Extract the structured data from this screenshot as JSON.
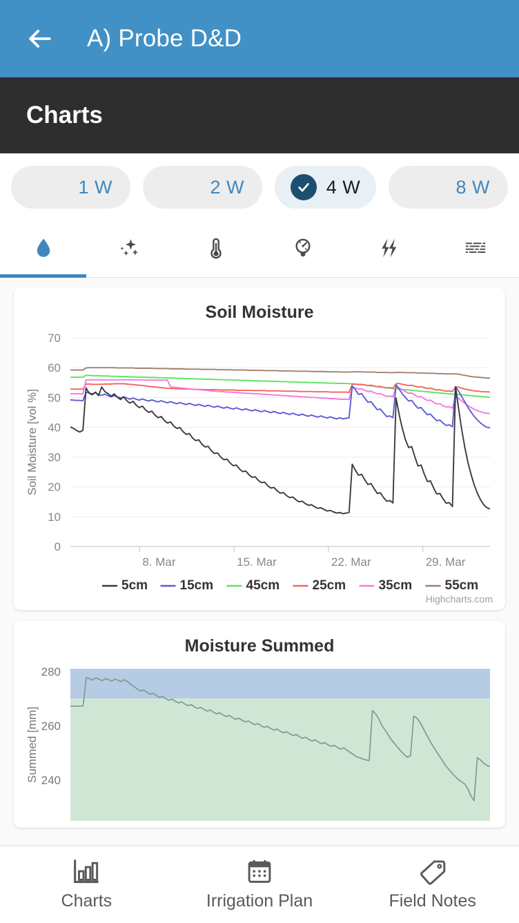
{
  "appbar": {
    "back_icon": "arrow-left-icon",
    "title": "A) Probe D&D",
    "bg_color": "#4191c6"
  },
  "section_header": {
    "title": "Charts",
    "bg_color": "#2e2e2e"
  },
  "range_chips": {
    "selected_index": 2,
    "check_icon": "check-circle-icon",
    "items": [
      {
        "label": "1 W",
        "selected": false
      },
      {
        "label": "2 W",
        "selected": false
      },
      {
        "label": "4 W",
        "selected": true
      },
      {
        "label": "8 W",
        "selected": false
      }
    ]
  },
  "metric_tabs": {
    "active_index": 0,
    "accent_color": "#3f87bf",
    "items": [
      {
        "icon": "water-drop-icon",
        "active": true
      },
      {
        "icon": "sparkles-icon",
        "active": false
      },
      {
        "icon": "thermometer-icon",
        "active": false
      },
      {
        "icon": "gauge-icon",
        "active": false
      },
      {
        "icon": "lightning-bolts-icon",
        "active": false
      },
      {
        "icon": "data-rows-icon",
        "active": false
      }
    ]
  },
  "chart_data": [
    {
      "type": "line",
      "title": "Soil Moisture",
      "xlabel": "",
      "ylabel": "Soil Moisture [vol %]",
      "ylim": [
        0,
        70
      ],
      "yticks": [
        0,
        10,
        20,
        30,
        40,
        50,
        60,
        70
      ],
      "xticks": [
        "8. Mar",
        "15. Mar",
        "22. Mar",
        "29. Mar"
      ],
      "xtick_positions": [
        0.165,
        0.39,
        0.615,
        0.84
      ],
      "grid": true,
      "legend_position": "bottom",
      "credits": "Highcharts.com",
      "series": [
        {
          "name": "5cm",
          "color": "#3a3a3a",
          "values": [
            40.1,
            39.6,
            38.9,
            38.4,
            39.0,
            53.2,
            51.4,
            50.9,
            51.8,
            50.6,
            53.5,
            52.0,
            51.3,
            50.4,
            51.2,
            50.1,
            49.3,
            50.2,
            48.9,
            48.1,
            48.7,
            47.4,
            46.6,
            47.1,
            45.8,
            45.0,
            45.4,
            44.1,
            43.2,
            43.6,
            42.3,
            41.4,
            41.8,
            40.4,
            39.6,
            39.9,
            38.5,
            37.6,
            37.9,
            36.4,
            35.5,
            35.8,
            34.3,
            33.4,
            33.6,
            32.1,
            31.2,
            31.4,
            30.0,
            29.1,
            29.3,
            28.0,
            27.1,
            27.3,
            26.0,
            25.1,
            25.3,
            24.1,
            23.2,
            23.4,
            22.2,
            21.4,
            21.6,
            20.4,
            19.6,
            19.8,
            18.7,
            17.9,
            18.1,
            17.1,
            16.4,
            16.6,
            15.7,
            15.0,
            15.2,
            14.4,
            13.8,
            14.0,
            13.3,
            12.8,
            13.0,
            12.4,
            11.9,
            12.1,
            11.6,
            11.2,
            11.4,
            11.0,
            11.2,
            11.4,
            27.6,
            25.6,
            23.9,
            24.2,
            22.4,
            20.8,
            21.1,
            19.4,
            17.8,
            18.0,
            16.4,
            15.2,
            15.4,
            14.6,
            49.8,
            44.2,
            39.6,
            35.8,
            33.2,
            33.5,
            30.1,
            27.0,
            27.3,
            24.3,
            21.8,
            22.0,
            19.6,
            17.6,
            17.8,
            16.0,
            14.5,
            14.7,
            13.4,
            53.5,
            46.0,
            39.0,
            33.0,
            28.0,
            24.0,
            20.5,
            17.8,
            15.6,
            14.0,
            13.0,
            12.6
          ]
        },
        {
          "name": "15cm",
          "color": "#5b5bd6",
          "values": [
            49.2,
            49.1,
            49.0,
            49.0,
            48.9,
            51.8,
            51.5,
            51.2,
            51.6,
            51.0,
            50.7,
            51.1,
            50.6,
            50.2,
            50.6,
            50.2,
            49.8,
            50.2,
            49.8,
            49.4,
            49.8,
            49.4,
            49.1,
            49.5,
            49.1,
            48.8,
            49.2,
            48.8,
            48.5,
            48.9,
            48.5,
            48.2,
            48.6,
            48.2,
            47.9,
            48.3,
            47.9,
            47.6,
            48.0,
            47.6,
            47.3,
            47.7,
            47.3,
            47.0,
            47.4,
            47.0,
            46.7,
            47.1,
            46.7,
            46.4,
            46.8,
            46.4,
            46.1,
            46.5,
            46.1,
            45.8,
            46.2,
            45.8,
            45.5,
            45.9,
            45.5,
            45.2,
            45.6,
            45.2,
            44.9,
            45.3,
            44.9,
            44.6,
            45.0,
            44.6,
            44.3,
            44.7,
            44.3,
            44.0,
            44.4,
            44.0,
            43.7,
            44.1,
            43.7,
            43.4,
            43.8,
            43.4,
            43.1,
            43.5,
            43.1,
            42.8,
            43.2,
            42.8,
            43.0,
            43.2,
            53.8,
            52.6,
            51.0,
            51.3,
            49.8,
            48.4,
            48.6,
            47.2,
            45.9,
            46.1,
            44.8,
            43.6,
            43.8,
            43.2,
            54.2,
            52.8,
            51.2,
            50.0,
            48.8,
            49.0,
            47.6,
            46.4,
            46.6,
            45.3,
            44.2,
            44.4,
            43.2,
            42.2,
            42.4,
            41.4,
            40.6,
            40.8,
            40.2,
            53.6,
            52.0,
            50.2,
            48.4,
            46.6,
            45.0,
            43.6,
            42.4,
            41.4,
            40.6,
            40.0,
            39.8
          ]
        },
        {
          "name": "45cm",
          "color": "#5ae65a",
          "values": [
            56.8,
            56.8,
            56.8,
            56.8,
            56.8,
            57.4,
            57.4,
            57.3,
            57.3,
            57.3,
            57.2,
            57.2,
            57.2,
            57.1,
            57.1,
            57.1,
            57.0,
            57.0,
            57.0,
            56.9,
            56.9,
            56.9,
            56.8,
            56.8,
            56.8,
            56.7,
            56.7,
            56.7,
            56.6,
            56.6,
            56.6,
            56.5,
            56.5,
            56.5,
            56.4,
            56.4,
            56.4,
            56.3,
            56.3,
            56.3,
            56.2,
            56.2,
            56.2,
            56.1,
            56.1,
            56.1,
            56.0,
            56.0,
            56.0,
            55.9,
            55.9,
            55.9,
            55.8,
            55.8,
            55.8,
            55.7,
            55.7,
            55.7,
            55.6,
            55.6,
            55.6,
            55.5,
            55.5,
            55.5,
            55.4,
            55.4,
            55.4,
            55.3,
            55.3,
            55.3,
            55.2,
            55.2,
            55.2,
            55.1,
            55.1,
            55.1,
            55.0,
            55.0,
            55.0,
            54.9,
            54.9,
            54.9,
            54.8,
            54.8,
            54.8,
            54.7,
            54.7,
            54.7,
            54.7,
            54.6,
            54.6,
            54.5,
            54.4,
            54.3,
            54.2,
            54.0,
            53.9,
            53.8,
            53.6,
            53.5,
            53.4,
            53.2,
            53.1,
            53.0,
            52.9,
            52.8,
            52.7,
            52.6,
            52.5,
            52.4,
            52.3,
            52.2,
            52.1,
            52.0,
            51.9,
            51.8,
            51.7,
            51.6,
            51.5,
            51.4,
            51.3,
            51.2,
            51.1,
            51.0,
            51.0,
            50.9,
            50.8,
            50.7,
            50.6,
            50.5,
            50.4,
            50.3,
            50.2,
            50.1,
            50.0,
            49.9
          ]
        },
        {
          "name": "25cm",
          "color": "#f4655c",
          "values": [
            52.8,
            52.8,
            52.8,
            52.8,
            52.8,
            54.5,
            54.5,
            54.4,
            54.4,
            54.4,
            54.4,
            54.5,
            54.5,
            54.5,
            54.6,
            54.6,
            54.6,
            54.6,
            54.5,
            54.4,
            54.3,
            54.2,
            54.1,
            54.0,
            53.9,
            53.7,
            53.6,
            53.5,
            53.4,
            53.3,
            53.2,
            53.1,
            53.0,
            53.0,
            52.9,
            52.9,
            52.8,
            52.8,
            52.8,
            52.7,
            52.7,
            52.7,
            52.7,
            52.6,
            52.6,
            52.6,
            52.6,
            52.6,
            52.5,
            52.5,
            52.5,
            52.5,
            52.5,
            52.4,
            52.4,
            52.4,
            52.4,
            52.4,
            52.3,
            52.3,
            52.3,
            52.3,
            52.3,
            52.2,
            52.2,
            52.2,
            52.2,
            52.2,
            52.1,
            52.1,
            52.1,
            52.1,
            52.1,
            52.0,
            52.0,
            52.0,
            52.0,
            52.0,
            51.9,
            51.9,
            51.9,
            51.9,
            51.9,
            51.8,
            51.8,
            51.8,
            51.8,
            51.8,
            51.8,
            51.7,
            54.4,
            54.5,
            54.3,
            54.4,
            54.2,
            54.0,
            54.1,
            53.8,
            53.6,
            53.7,
            53.4,
            53.2,
            53.3,
            53.1,
            54.6,
            54.7,
            54.4,
            54.2,
            54.0,
            54.1,
            53.8,
            53.5,
            53.6,
            53.3,
            53.0,
            53.1,
            52.8,
            52.5,
            52.6,
            52.3,
            52.1,
            52.2,
            52.0,
            53.6,
            53.4,
            53.1,
            52.8,
            52.6,
            52.4,
            52.2,
            52.1,
            52.0,
            51.9,
            51.9,
            51.8
          ]
        },
        {
          "name": "35cm",
          "color": "#f27ae0",
          "values": [
            51.2,
            51.2,
            51.2,
            51.2,
            51.2,
            55.9,
            55.9,
            55.9,
            55.9,
            55.9,
            55.9,
            55.9,
            55.9,
            55.9,
            55.9,
            55.9,
            55.9,
            55.9,
            55.9,
            55.9,
            55.9,
            55.9,
            55.9,
            55.9,
            55.8,
            55.8,
            55.8,
            55.8,
            55.8,
            55.8,
            55.8,
            55.8,
            53.5,
            53.4,
            53.3,
            53.2,
            53.1,
            53.0,
            52.9,
            52.8,
            52.7,
            52.6,
            52.5,
            52.4,
            52.3,
            52.2,
            52.1,
            52.0,
            52.0,
            51.9,
            51.8,
            51.8,
            51.7,
            51.6,
            51.6,
            51.5,
            51.4,
            51.4,
            51.3,
            51.2,
            51.2,
            51.1,
            51.0,
            51.0,
            50.9,
            50.8,
            50.8,
            50.7,
            50.6,
            50.6,
            50.5,
            50.4,
            50.4,
            50.3,
            50.2,
            50.2,
            50.1,
            50.0,
            50.0,
            49.9,
            49.8,
            49.8,
            49.7,
            49.6,
            49.6,
            49.5,
            49.4,
            49.4,
            49.4,
            49.3,
            53.4,
            53.2,
            52.8,
            52.9,
            52.4,
            52.0,
            52.1,
            51.6,
            51.2,
            51.3,
            50.8,
            50.4,
            50.5,
            50.2,
            53.6,
            53.2,
            52.6,
            52.0,
            51.4,
            51.5,
            50.8,
            50.2,
            50.3,
            49.6,
            49.0,
            49.1,
            48.4,
            47.8,
            47.9,
            47.2,
            46.8,
            46.9,
            46.4,
            50.2,
            49.6,
            48.8,
            48.0,
            47.2,
            46.6,
            46.0,
            45.6,
            45.2,
            44.9,
            44.7,
            44.6
          ]
        },
        {
          "name": "55cm",
          "color": "#a08070",
          "values": [
            59.2,
            59.2,
            59.2,
            59.2,
            59.2,
            59.9,
            60.0,
            60.0,
            60.0,
            60.0,
            60.0,
            60.0,
            60.0,
            60.0,
            60.0,
            59.9,
            59.9,
            59.9,
            59.9,
            59.9,
            59.9,
            59.8,
            59.8,
            59.8,
            59.8,
            59.8,
            59.8,
            59.7,
            59.7,
            59.7,
            59.7,
            59.7,
            59.6,
            59.6,
            59.6,
            59.6,
            59.6,
            59.5,
            59.5,
            59.5,
            59.5,
            59.5,
            59.4,
            59.4,
            59.4,
            59.4,
            59.4,
            59.3,
            59.3,
            59.3,
            59.3,
            59.3,
            59.2,
            59.2,
            59.2,
            59.2,
            59.2,
            59.1,
            59.1,
            59.1,
            59.1,
            59.1,
            59.0,
            59.0,
            59.0,
            59.0,
            59.0,
            58.9,
            58.9,
            58.9,
            58.9,
            58.9,
            58.8,
            58.8,
            58.8,
            58.8,
            58.8,
            58.7,
            58.7,
            58.7,
            58.7,
            58.7,
            58.6,
            58.6,
            58.6,
            58.6,
            58.6,
            58.5,
            58.5,
            58.5,
            58.6,
            58.6,
            58.6,
            58.6,
            58.5,
            58.5,
            58.5,
            58.5,
            58.4,
            58.4,
            58.4,
            58.4,
            58.3,
            58.3,
            58.4,
            58.4,
            58.4,
            58.3,
            58.3,
            58.3,
            58.3,
            58.2,
            58.2,
            58.2,
            58.1,
            58.1,
            58.1,
            58.0,
            58.0,
            58.0,
            57.9,
            57.9,
            57.9,
            57.9,
            57.8,
            57.6,
            57.4,
            57.2,
            57.0,
            56.9,
            56.8,
            56.7,
            56.6,
            56.5,
            56.5
          ]
        }
      ]
    },
    {
      "type": "area",
      "title": "Moisture Summed",
      "xlabel": "",
      "ylabel": "Summed [mm]",
      "ylim": [
        225,
        281
      ],
      "yticks": [
        240,
        260,
        280
      ],
      "grid": false,
      "line_color": "#7e9a8e",
      "bands": [
        {
          "from": 270,
          "to": 281,
          "color": "#b6cbe4"
        },
        {
          "from": 225,
          "to": 270,
          "color": "#cfe6d4"
        }
      ],
      "values": [
        267.2,
        267.2,
        267.2,
        267.3,
        267.3,
        277.8,
        277.4,
        276.8,
        277.6,
        277.2,
        276.6,
        277.4,
        277.0,
        276.4,
        277.2,
        276.8,
        276.2,
        277.0,
        276.2,
        275.2,
        274.4,
        273.6,
        272.8,
        273.2,
        272.4,
        271.6,
        272.0,
        271.2,
        270.4,
        270.8,
        270.0,
        269.4,
        269.8,
        269.0,
        268.4,
        268.8,
        268.0,
        267.4,
        267.8,
        267.0,
        266.4,
        266.8,
        266.0,
        265.4,
        265.8,
        265.0,
        264.4,
        264.8,
        264.0,
        263.4,
        263.8,
        263.0,
        262.4,
        262.8,
        262.0,
        261.4,
        261.8,
        261.0,
        260.4,
        260.8,
        260.0,
        259.4,
        259.8,
        259.0,
        258.4,
        258.8,
        258.0,
        257.4,
        257.8,
        257.0,
        256.4,
        256.8,
        256.0,
        255.4,
        255.8,
        255.0,
        254.4,
        254.8,
        254.0,
        253.4,
        253.8,
        253.0,
        252.4,
        252.8,
        252.0,
        251.4,
        251.8,
        251.0,
        250.2,
        249.4,
        248.6,
        248.2,
        247.8,
        247.4,
        247.2,
        265.6,
        264.4,
        262.6,
        260.0,
        258.4,
        256.6,
        254.8,
        253.4,
        252.0,
        250.6,
        249.4,
        248.4,
        249.0,
        263.6,
        262.8,
        261.2,
        259.0,
        256.8,
        254.6,
        252.6,
        250.8,
        249.0,
        247.2,
        245.4,
        244.0,
        242.6,
        241.4,
        240.2,
        239.4,
        238.6,
        236.8,
        234.2,
        232.4,
        248.2,
        247.4,
        246.2,
        245.4,
        245.0
      ]
    }
  ],
  "bottom_nav": {
    "active_index": 0,
    "items": [
      {
        "label": "Charts",
        "icon": "bar-chart-icon"
      },
      {
        "label": "Irrigation Plan",
        "icon": "calendar-icon"
      },
      {
        "label": "Field Notes",
        "icon": "tag-icon"
      }
    ]
  }
}
